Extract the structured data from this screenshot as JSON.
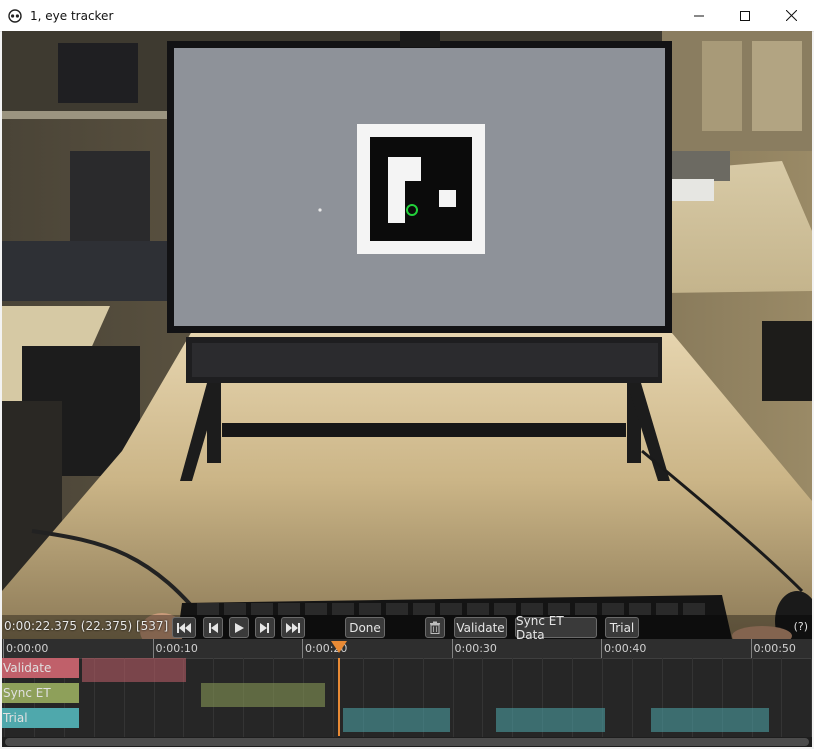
{
  "window": {
    "title": "1, eye tracker",
    "icon": "glasses-icon"
  },
  "player": {
    "timecode": "0:00:22.375 (22.375) [537]",
    "buttons": {
      "done_label": "Done",
      "validate_label": "Validate",
      "sync_label": "Sync ET Data",
      "trial_label": "Trial"
    },
    "help_label": "(?)"
  },
  "timeline": {
    "ticks": [
      "0:00:00",
      "0:00:10",
      "0:00:20",
      "0:00:30",
      "0:00:40",
      "0:00:50"
    ],
    "tick_seconds": [
      0,
      10,
      20,
      30,
      40,
      50
    ],
    "playhead_seconds": 22.375,
    "tracks": [
      {
        "label": "Validate",
        "color": "#c0606a",
        "segments": [
          [
            5.2,
            12.2
          ]
        ]
      },
      {
        "label": "Sync ET Data",
        "color": "#8ea05a",
        "segments": [
          [
            13.2,
            21.5
          ]
        ]
      },
      {
        "label": "Trial",
        "color": "#4fa8ac",
        "segments": [
          [
            22.7,
            29.8
          ],
          [
            32.9,
            40.2
          ],
          [
            43.3,
            51.2
          ]
        ]
      }
    ]
  },
  "colors": {
    "accent_playhead": "#e88a35",
    "gaze_marker": "#22d03a"
  }
}
